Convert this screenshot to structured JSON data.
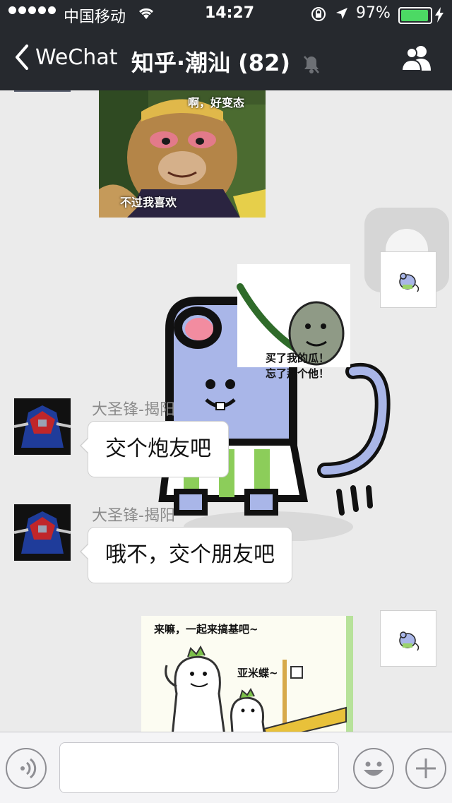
{
  "status_bar": {
    "carrier": "中国移动",
    "time": "14:27",
    "battery": "97%",
    "battery_color": "#4cd964"
  },
  "nav": {
    "back_label": "WeChat",
    "title": "知乎·潮汕 (82)",
    "icons": [
      "chevron-left-icon",
      "mute-bell-icon",
      "group-contacts-icon"
    ]
  },
  "messages": [
    {
      "type": "image",
      "side": "left",
      "sticker": "monkey-king",
      "caption_top": "啊，好变态",
      "caption_bottom": "不过我喜欢"
    },
    {
      "type": "image",
      "side": "right",
      "sticker": "mouse-sword",
      "caption": "买了我的瓜！\n忘了那个他！"
    },
    {
      "type": "text",
      "side": "left",
      "sender": "大圣锋-揭阳",
      "text": "交个炮友吧"
    },
    {
      "type": "text",
      "side": "left",
      "sender": "大圣锋-揭阳",
      "text": "哦不，交个朋友吧"
    },
    {
      "type": "image",
      "side": "right",
      "sticker": "radish-dance",
      "caption_1": "来嘛，一起来搞基吧~",
      "caption_2": "亚米蝶~"
    }
  ],
  "input_bar": {
    "icons": [
      "voice-icon",
      "emoji-icon",
      "plus-icon"
    ]
  }
}
